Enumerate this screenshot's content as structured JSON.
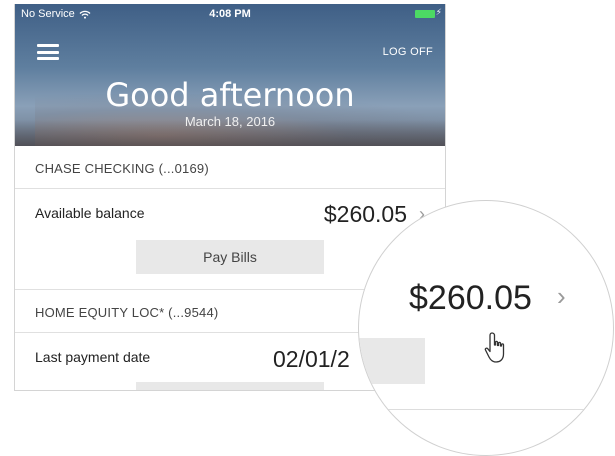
{
  "status_bar": {
    "carrier": "No Service",
    "time": "4:08 PM"
  },
  "header": {
    "menu_icon": "hamburger-menu-icon",
    "logoff_label": "LOG OFF",
    "greeting": "Good afternoon",
    "date": "March 18, 2016"
  },
  "accounts": [
    {
      "title": "CHASE CHECKING  (...0169)",
      "row_label": "Available balance",
      "row_value": "$260.05",
      "button_label": "Pay Bills"
    },
    {
      "title": "HOME EQUITY LOC*  (...9544)",
      "row_label": "Last payment date",
      "row_value": "02/01/2"
    }
  ],
  "zoom": {
    "value": "$260.05"
  },
  "colors": {
    "battery": "#4cd964",
    "button_bg": "#e8e8e8",
    "chevron": "#9a9a9a"
  },
  "icons": {
    "wifi": "wifi-icon",
    "battery": "battery-icon",
    "chevron": "chevron-right-icon",
    "cursor": "hand-pointer-icon"
  }
}
